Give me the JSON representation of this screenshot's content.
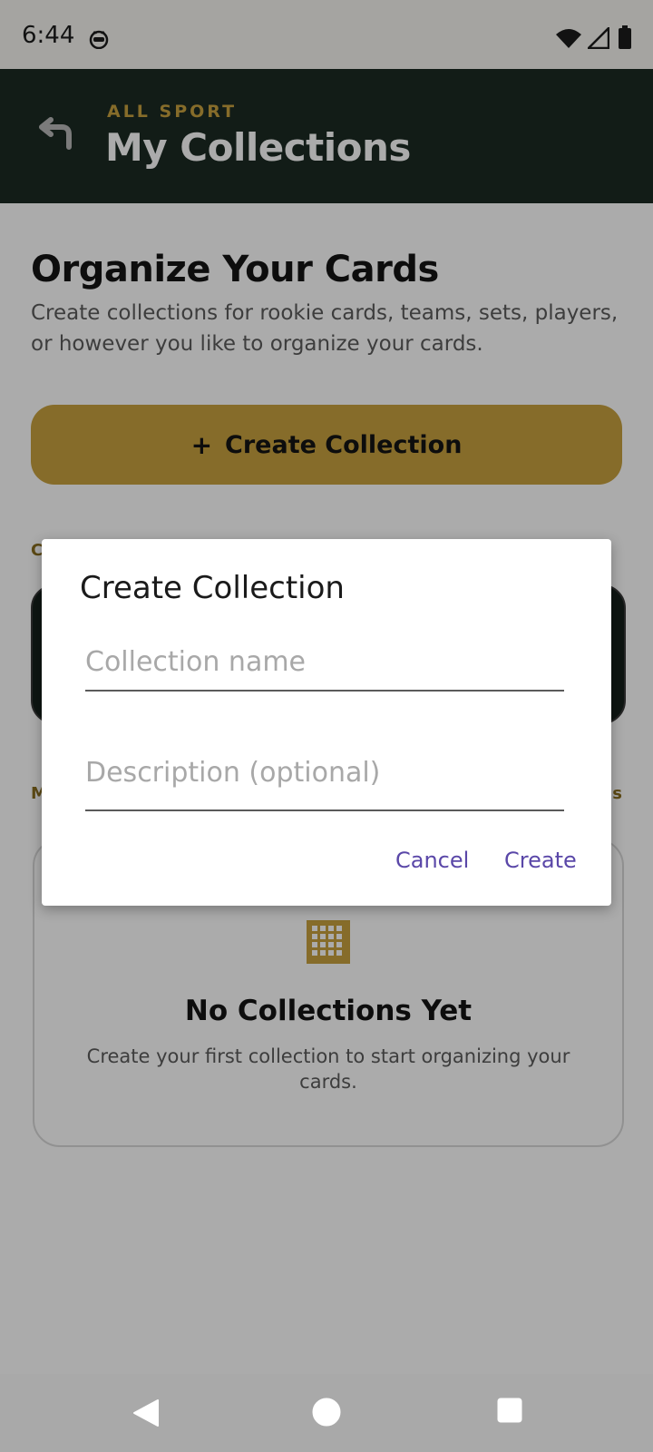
{
  "status_bar": {
    "time": "6:44",
    "icons": [
      "cat-icon",
      "wifi-icon",
      "signal-icon",
      "battery-icon"
    ]
  },
  "app_bar": {
    "eyebrow": "ALL SPORT",
    "title": "My Collections",
    "back_icon": "back-icon"
  },
  "main": {
    "heading": "Organize Your Cards",
    "subtext": "Create collections for rookie cards, teams, sets, players, or however you like to organize your cards.",
    "create_button": {
      "icon": "+",
      "label": "Create Collection"
    },
    "section_labels": {
      "top_left": "C",
      "middle_left": "M",
      "middle_right": "s"
    },
    "empty_state": {
      "icon": "grid-icon",
      "title": "No Collections Yet",
      "text": "Create your first collection to start organizing your cards."
    }
  },
  "dialog": {
    "title": "Create Collection",
    "name_placeholder": "Collection name",
    "description_placeholder": "Description (optional)",
    "cancel_label": "Cancel",
    "create_label": "Create"
  },
  "nav_bar": {
    "icons": [
      "back-triangle-icon",
      "home-circle-icon",
      "recents-square-icon"
    ]
  },
  "colors": {
    "accent": "#c8a23f",
    "header": "#1c2b23",
    "dialog_button": "#5a47a8"
  }
}
